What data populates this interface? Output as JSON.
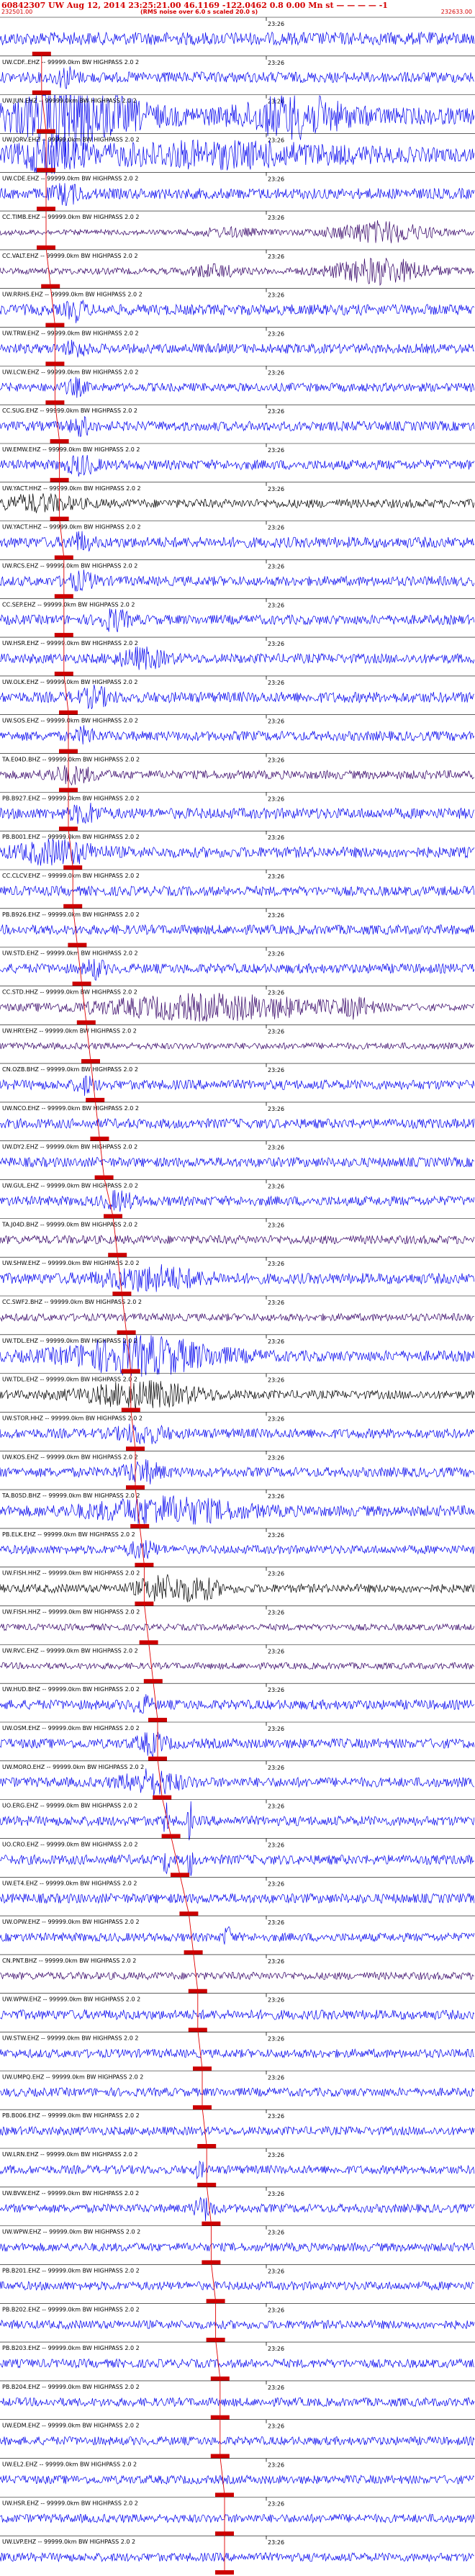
{
  "header": {
    "line1": "60842307 UW Aug 12, 2014 23:25:21.00    46.1169 -122.0462   0.8 0.00 Mn st — — — — -1",
    "start_time": "232501.00",
    "note": "(RMS noise over 6.0 s scaled 20.0 s)",
    "end_time": "232633.00"
  },
  "colors": {
    "header_text": "#d40000",
    "pick_marker": "#cc0000",
    "trace_blue": "#0000ee",
    "trace_purple": "#330066",
    "trace_black": "#000000",
    "divider": "#000000",
    "move_out_line": "#e00000"
  },
  "chart_data": {
    "type": "record-section",
    "time_tick_label": "23:26",
    "channels": [
      {
        "label": "",
        "color": "blue",
        "amp": 0.6,
        "pick": 0.04,
        "bursts": []
      },
      {
        "label": "UW.CDF..EHZ -- 99999.0km BW  HIGHPASS  2.0  2",
        "color": "blue",
        "amp": 0.5,
        "pick": 0.04,
        "bursts": [
          [
            0.14,
            0.02,
            1.5
          ]
        ]
      },
      {
        "label": "UW.JUN.EHZ -- 99999.0km BW  HIGHPASS  2.0  2",
        "color": "blue",
        "amp": 0.8,
        "pick": 0.05,
        "bursts": [
          [
            0.14,
            0.03,
            3
          ],
          [
            0.15,
            0.14,
            2.5
          ],
          [
            0.62,
            0.1,
            1.8
          ]
        ]
      },
      {
        "label": "UW.JORV.EHZ -- 99999.0km BW  HIGHPASS  2.0  2",
        "color": "blue",
        "amp": 0.6,
        "pick": 0.05,
        "bursts": [
          [
            0.1,
            0.06,
            2
          ],
          [
            0.45,
            0.3,
            1.4
          ]
        ]
      },
      {
        "label": "UW.CDE.EHZ -- 99999.0km BW  HIGHPASS  2.0  2",
        "color": "blue",
        "amp": 0.5,
        "pick": 0.05,
        "bursts": [
          [
            0.14,
            0.03,
            1.4
          ]
        ]
      },
      {
        "label": "CC.TIMB.EHZ -- 99999.0km BW  HIGHPASS  2.0  2",
        "color": "purple",
        "amp": 0.25,
        "pick": 0.05,
        "bursts": [
          [
            0.8,
            0.1,
            3.5
          ],
          [
            0.48,
            0.06,
            1.2
          ]
        ]
      },
      {
        "label": "CC.VALT.EHZ -- 99999.0km BW  HIGHPASS  2.0  2",
        "color": "purple",
        "amp": 0.3,
        "pick": 0.06,
        "bursts": [
          [
            0.8,
            0.1,
            3.5
          ],
          [
            0.45,
            0.05,
            1.5
          ]
        ]
      },
      {
        "label": "UW.RRHS.EHZ -- 99999.0km BW  HIGHPASS  2.0  2",
        "color": "blue",
        "amp": 0.5,
        "pick": 0.07,
        "bursts": [
          [
            0.16,
            0.02,
            1.5
          ]
        ]
      },
      {
        "label": "UW.TRW.EHZ -- 99999.0km BW  HIGHPASS  2.0  2",
        "color": "blue",
        "amp": 0.45,
        "pick": 0.07,
        "bursts": [
          [
            0.16,
            0.02,
            1.4
          ]
        ]
      },
      {
        "label": "UW.LCW.EHZ -- 99999.0km BW  HIGHPASS  2.0  2",
        "color": "blue",
        "amp": 0.4,
        "pick": 0.07,
        "bursts": [
          [
            0.16,
            0.02,
            1.5
          ]
        ]
      },
      {
        "label": "CC.SUG.EHZ -- 99999.0km BW  HIGHPASS  2.0  2",
        "color": "blue",
        "amp": 0.45,
        "pick": 0.08,
        "bursts": [
          [
            0.17,
            0.02,
            1.6
          ]
        ]
      },
      {
        "label": "UW.EMW.EHZ -- 99999.0km BW  HIGHPASS  2.0  2",
        "color": "blue",
        "amp": 0.45,
        "pick": 0.08,
        "bursts": [
          [
            0.17,
            0.03,
            1.6
          ]
        ]
      },
      {
        "label": "UW.YACT.HHZ -- 99999.0km BW  HIGHPASS  2.0  2",
        "color": "black",
        "amp": 0.4,
        "pick": 0.08,
        "bursts": [
          [
            0.08,
            0.08,
            1.5
          ]
        ]
      },
      {
        "label": "UW.YACT.HHZ -- 99999.0km BW  HIGHPASS  2.0  2",
        "color": "blue",
        "amp": 0.5,
        "pick": 0.09,
        "bursts": [
          [
            0.17,
            0.02,
            1.4
          ]
        ]
      },
      {
        "label": "UW.RCS.EHZ -- 99999.0km BW  HIGHPASS  2.0  2",
        "color": "blue",
        "amp": 0.45,
        "pick": 0.09,
        "bursts": [
          [
            0.17,
            0.03,
            1.4
          ]
        ]
      },
      {
        "label": "CC.SEP.EHZ -- 99999.0km BW  HIGHPASS  2.0  2",
        "color": "blue",
        "amp": 0.45,
        "pick": 0.09,
        "bursts": [
          [
            0.24,
            0.03,
            1.8
          ]
        ]
      },
      {
        "label": "UW.HSR.EHZ -- 99999.0km BW  HIGHPASS  2.0  2",
        "color": "blue",
        "amp": 0.45,
        "pick": 0.09,
        "bursts": [
          [
            0.3,
            0.05,
            1.6
          ]
        ]
      },
      {
        "label": "UW.OLK.EHZ -- 99999.0km BW  HIGHPASS  2.0  2",
        "color": "blue",
        "amp": 0.5,
        "pick": 0.1,
        "bursts": [
          [
            0.2,
            0.03,
            1.4
          ]
        ]
      },
      {
        "label": "UW.SOS.EHZ -- 99999.0km BW  HIGHPASS  2.0  2",
        "color": "blue",
        "amp": 0.45,
        "pick": 0.1,
        "bursts": [
          [
            0.18,
            0.02,
            1.3
          ]
        ]
      },
      {
        "label": "TA.E04D.BHZ -- 99999.0km BW  HIGHPASS  2.0  2",
        "color": "purple",
        "amp": 0.4,
        "pick": 0.1,
        "bursts": [
          [
            0.15,
            0.05,
            1.5
          ]
        ]
      },
      {
        "label": "PB.B927.EHZ -- 99999.0km BW  HIGHPASS  2.0  2",
        "color": "blue",
        "amp": 0.5,
        "pick": 0.1,
        "bursts": [
          [
            0.18,
            0.03,
            1.4
          ]
        ]
      },
      {
        "label": "PB.B001.EHZ -- 99999.0km BW  HIGHPASS  2.0  2",
        "color": "blue",
        "amp": 0.5,
        "pick": 0.11,
        "bursts": [
          [
            0.12,
            0.08,
            1.8
          ]
        ]
      },
      {
        "label": "CC.CLCV.EHZ -- 99999.0km BW  HIGHPASS  2.0  2",
        "color": "blue",
        "amp": 0.45,
        "pick": 0.11,
        "bursts": []
      },
      {
        "label": "PB.B926.EHZ -- 99999.0km BW  HIGHPASS  2.0  2",
        "color": "blue",
        "amp": 0.45,
        "pick": 0.12,
        "bursts": []
      },
      {
        "label": "UW.STD.EHZ -- 99999.0km BW  HIGHPASS  2.0  2",
        "color": "blue",
        "amp": 0.45,
        "pick": 0.13,
        "bursts": [
          [
            0.2,
            0.02,
            1.6
          ]
        ]
      },
      {
        "label": "CC.STD.HHZ -- 99999.0km BW  HIGHPASS  2.0  2",
        "color": "purple",
        "amp": 0.3,
        "pick": 0.14,
        "bursts": [
          [
            0.45,
            0.25,
            3.5
          ],
          [
            0.75,
            0.03,
            2
          ]
        ]
      },
      {
        "label": "UW.HRY.EHZ -- 99999.0km BW  HIGHPASS  2.0  2",
        "color": "purple",
        "amp": 0.3,
        "pick": 0.15,
        "bursts": []
      },
      {
        "label": "CN.OZB.BHZ -- 99999.0km BW  HIGHPASS  2.0  2",
        "color": "blue",
        "amp": 0.45,
        "pick": 0.16,
        "bursts": [
          [
            0.18,
            0.02,
            1.4
          ]
        ]
      },
      {
        "label": "UW.NCO.EHZ -- 99999.0km BW  HIGHPASS  2.0  2",
        "color": "blue",
        "amp": 0.45,
        "pick": 0.17,
        "bursts": []
      },
      {
        "label": "UW.DY2.EHZ -- 99999.0km BW  HIGHPASS  2.0  2",
        "color": "blue",
        "amp": 0.45,
        "pick": 0.18,
        "bursts": []
      },
      {
        "label": "UW.GUL.EHZ -- 99999.0km BW  HIGHPASS  2.0  2",
        "color": "blue",
        "amp": 0.45,
        "pick": 0.2,
        "bursts": [
          [
            0.25,
            0.03,
            1.5
          ]
        ]
      },
      {
        "label": "TA.J04D.BHZ -- 99999.0km BW  HIGHPASS  2.0  2",
        "color": "purple",
        "amp": 0.4,
        "pick": 0.21,
        "bursts": []
      },
      {
        "label": "UW.SHW.EHZ -- 99999.0km BW  HIGHPASS  2.0  2",
        "color": "blue",
        "amp": 0.5,
        "pick": 0.22,
        "bursts": [
          [
            0.32,
            0.1,
            1.8
          ]
        ]
      },
      {
        "label": "CC.SWF2.BHZ -- 99999.0km BW  HIGHPASS  2.0  2",
        "color": "purple",
        "amp": 0.35,
        "pick": 0.23,
        "bursts": []
      },
      {
        "label": "UW.TDL.EHZ -- 99999.0km BW  HIGHPASS  2.0  2",
        "color": "blue",
        "amp": 0.5,
        "pick": 0.24,
        "bursts": [
          [
            0.3,
            0.15,
            3
          ]
        ]
      },
      {
        "label": "UW.TDL.EHZ -- 99999.0km BW  HIGHPASS  2.0  2",
        "color": "black",
        "amp": 0.4,
        "pick": 0.24,
        "bursts": [
          [
            0.3,
            0.12,
            2.5
          ]
        ]
      },
      {
        "label": "UW.STOR.HHZ -- 99999.0km BW  HIGHPASS  2.0  2",
        "color": "blue",
        "amp": 0.45,
        "pick": 0.25,
        "bursts": [
          [
            0.3,
            0.05,
            1.5
          ]
        ]
      },
      {
        "label": "UW.KOS.EHZ -- 99999.0km BW  HIGHPASS  2.0  2",
        "color": "blue",
        "amp": 0.45,
        "pick": 0.25,
        "bursts": [
          [
            0.3,
            0.04,
            1.8
          ]
        ]
      },
      {
        "label": "TA.B05D.BHZ -- 99999.0km BW  HIGHPASS  2.0  2",
        "color": "blue",
        "amp": 0.5,
        "pick": 0.26,
        "bursts": [
          [
            0.35,
            0.15,
            2
          ]
        ]
      },
      {
        "label": "PB.ELK.EHZ -- 99999.0km BW  HIGHPASS  2.0  2",
        "color": "blue",
        "amp": 0.4,
        "pick": 0.27,
        "bursts": [
          [
            0.3,
            0.03,
            1.6
          ]
        ]
      },
      {
        "label": "UW.FISH.HHZ -- 99999.0km BW  HIGHPASS  2.0  2",
        "color": "black",
        "amp": 0.4,
        "pick": 0.27,
        "bursts": [
          [
            0.34,
            0.05,
            2.5
          ],
          [
            0.42,
            0.04,
            2.2
          ]
        ]
      },
      {
        "label": "UW.FISH.HHZ -- 99999.0km BW  HIGHPASS  2.0  2",
        "color": "purple",
        "amp": 0.3,
        "pick": 0.28,
        "bursts": []
      },
      {
        "label": "UW.RVC.EHZ -- 99999.0km BW  HIGHPASS  2.0  2",
        "color": "purple",
        "amp": 0.3,
        "pick": 0.29,
        "bursts": []
      },
      {
        "label": "UW.HUD.BHZ -- 99999.0km BW  HIGHPASS  2.0  2",
        "color": "blue",
        "amp": 0.45,
        "pick": 0.3,
        "bursts": [
          [
            0.3,
            0.02,
            1.4
          ]
        ]
      },
      {
        "label": "UW.OSM.EHZ -- 99999.0km BW  HIGHPASS  2.0  2",
        "color": "blue",
        "amp": 0.45,
        "pick": 0.3,
        "bursts": [
          [
            0.32,
            0.03,
            1.8
          ]
        ]
      },
      {
        "label": "UW.MORO.EHZ -- 99999.0km BW  HIGHPASS  2.0  2",
        "color": "blue",
        "amp": 0.45,
        "pick": 0.31,
        "bursts": [
          [
            0.32,
            0.06,
            2
          ]
        ]
      },
      {
        "label": "UO.ERG.EHZ -- 99999.0km BW  HIGHPASS  2.0  2",
        "color": "blue",
        "amp": 0.45,
        "pick": 0.33,
        "bursts": [
          [
            0.35,
            0.005,
            3.5
          ],
          [
            0.4,
            0.005,
            3.5
          ]
        ]
      },
      {
        "label": "UO.CRO.EHZ -- 99999.0km BW  HIGHPASS  2.0  2",
        "color": "blue",
        "amp": 0.45,
        "pick": 0.35,
        "bursts": [
          [
            0.35,
            0.005,
            3.5
          ],
          [
            0.4,
            0.005,
            3.5
          ]
        ]
      },
      {
        "label": "UW.ET4.EHZ -- 99999.0km BW  HIGHPASS  2.0  2",
        "color": "blue",
        "amp": 0.45,
        "pick": 0.37,
        "bursts": []
      },
      {
        "label": "UW.OPW.EHZ -- 99999.0km BW  HIGHPASS  2.0  2",
        "color": "blue",
        "amp": 0.4,
        "pick": 0.38,
        "bursts": [
          [
            0.48,
            0.01,
            2
          ]
        ]
      },
      {
        "label": "CN.PNT.BHZ -- 99999.0km BW  HIGHPASS  2.0  2",
        "color": "purple",
        "amp": 0.35,
        "pick": 0.39,
        "bursts": []
      },
      {
        "label": "UW.WPW.EHZ -- 99999.0km BW  HIGHPASS  2.0  2",
        "color": "blue",
        "amp": 0.45,
        "pick": 0.39,
        "bursts": []
      },
      {
        "label": "UW.STW.EHZ -- 99999.0km BW  HIGHPASS  2.0  2",
        "color": "blue",
        "amp": 0.4,
        "pick": 0.4,
        "bursts": []
      },
      {
        "label": "UW.UMPQ.EHZ -- 99999.0km BW  HIGHPASS  2.0  2",
        "color": "blue",
        "amp": 0.4,
        "pick": 0.4,
        "bursts": []
      },
      {
        "label": "PB.B006.EHZ -- 99999.0km BW  HIGHPASS  2.0  2",
        "color": "blue",
        "amp": 0.4,
        "pick": 0.41,
        "bursts": []
      },
      {
        "label": "UW.LRN.EHZ -- 99999.0km BW  HIGHPASS  2.0  2",
        "color": "blue",
        "amp": 0.4,
        "pick": 0.41,
        "bursts": [
          [
            0.42,
            0.01,
            1.5
          ]
        ]
      },
      {
        "label": "UW.BVW.EHZ -- 99999.0km BW  HIGHPASS  2.0  2",
        "color": "blue",
        "amp": 0.4,
        "pick": 0.42,
        "bursts": [
          [
            0.43,
            0.02,
            2.2
          ]
        ]
      },
      {
        "label": "UW.WPW.EHZ -- 99999.0km BW  HIGHPASS  2.0  2",
        "color": "blue",
        "amp": 0.4,
        "pick": 0.42,
        "bursts": []
      },
      {
        "label": "PB.B201.EHZ -- 99999.0km BW  HIGHPASS  2.0  2",
        "color": "blue",
        "amp": 0.4,
        "pick": 0.43,
        "bursts": []
      },
      {
        "label": "PB.B202.EHZ -- 99999.0km BW  HIGHPASS  2.0  2",
        "color": "blue",
        "amp": 0.4,
        "pick": 0.43,
        "bursts": []
      },
      {
        "label": "PB.B203.EHZ -- 99999.0km BW  HIGHPASS  2.0  2",
        "color": "blue",
        "amp": 0.4,
        "pick": 0.44,
        "bursts": []
      },
      {
        "label": "PB.B204.EHZ -- 99999.0km BW  HIGHPASS  2.0  2",
        "color": "blue",
        "amp": 0.4,
        "pick": 0.44,
        "bursts": []
      },
      {
        "label": "UW.EDM.EHZ -- 99999.0km BW  HIGHPASS  2.0  2",
        "color": "blue",
        "amp": 0.4,
        "pick": 0.44,
        "bursts": []
      },
      {
        "label": "UW.EL2.EHZ -- 99999.0km BW  HIGHPASS  2.0  2",
        "color": "blue",
        "amp": 0.4,
        "pick": 0.45,
        "bursts": []
      },
      {
        "label": "UW.HSR.EHZ -- 99999.0km BW  HIGHPASS  2.0  2",
        "color": "blue",
        "amp": 0.4,
        "pick": 0.45,
        "bursts": []
      },
      {
        "label": "UW.LVP.EHZ -- 99999.0km BW  HIGHPASS  2.0  2",
        "color": "blue",
        "amp": 0.4,
        "pick": 0.45,
        "bursts": []
      }
    ]
  }
}
